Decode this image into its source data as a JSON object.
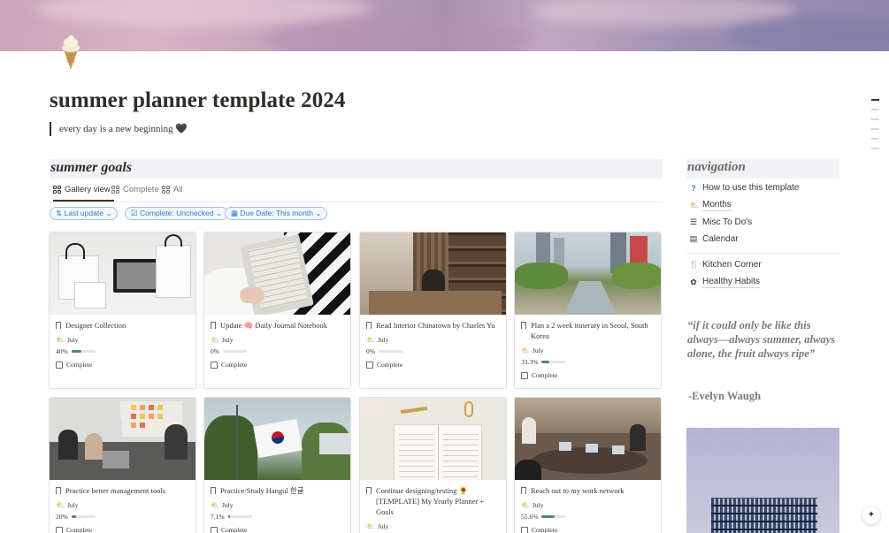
{
  "page": {
    "title": "summer planner template 2024",
    "subtitle": "every day is a new beginning 🖤"
  },
  "goals": {
    "heading": "summer goals",
    "views": [
      {
        "label": "Gallery view",
        "icon": "gallery-icon"
      },
      {
        "label": "Complete",
        "icon": "gallery-icon"
      },
      {
        "label": "All",
        "icon": "gallery-icon"
      }
    ],
    "filters": [
      {
        "label": "Last update",
        "icon": "sort-arrow-icon"
      },
      {
        "label": "Complete: Unchecked",
        "icon": "checkbox-icon"
      },
      {
        "label": "Due Date: This month",
        "icon": "calendar-icon"
      }
    ],
    "cards": [
      {
        "title": "Designer Collection",
        "month": "July",
        "progress_label": "40%",
        "progress": 0.4,
        "complete_label": "Complete"
      },
      {
        "title": "Update 🧠 Daily Journal Notebook",
        "month": "July",
        "progress_label": "0%",
        "progress": 0.0,
        "complete_label": "Complete"
      },
      {
        "title": "Read Interior Chinatown by Charles Yu",
        "month": "July",
        "progress_label": "0%",
        "progress": 0.0,
        "complete_label": "Complete"
      },
      {
        "title": "Plan a 2 week itinerary in Seoul, South Korea",
        "month": "July",
        "progress_label": "33.3%",
        "progress": 0.333,
        "complete_label": "Complete"
      },
      {
        "title": "Practice better management tools",
        "month": "July",
        "progress_label": "20%",
        "progress": 0.2,
        "complete_label": "Complete"
      },
      {
        "title": "Practice/Study Hangul 한글",
        "month": "July",
        "progress_label": "7.1%",
        "progress": 0.071,
        "complete_label": "Complete"
      },
      {
        "title": "Continue designing/testing 🌻 [TEMPLATE] My Yearly Planner + Goals",
        "month": "July",
        "progress_label": "",
        "progress": 0.0,
        "complete_label": ""
      },
      {
        "title": "Reach out to my work network",
        "month": "July",
        "progress_label": "55.6%",
        "progress": 0.556,
        "complete_label": "Complete"
      }
    ]
  },
  "navigation": {
    "heading": "navigation",
    "items": [
      {
        "label": "How to use this template",
        "icon": "question-icon"
      },
      {
        "label": "Months",
        "icon": "cloud-sun-icon"
      },
      {
        "label": "Misc To Do's",
        "icon": "list-icon"
      },
      {
        "label": "Calendar",
        "icon": "calendar-icon"
      },
      {
        "label": "Kitchen Corner",
        "icon": "fork-knife-icon"
      },
      {
        "label": "Healthy Habits",
        "icon": "brain-icon"
      }
    ],
    "quote": "“if it could only be like this always—always summer, always alone, the fruit always ripe”",
    "author": "-Evelyn Waugh"
  },
  "colors": {
    "accent_blue": "#2f7ad2",
    "progress_green": "#4f8a67",
    "heading_bg": "#f2f1f6"
  }
}
